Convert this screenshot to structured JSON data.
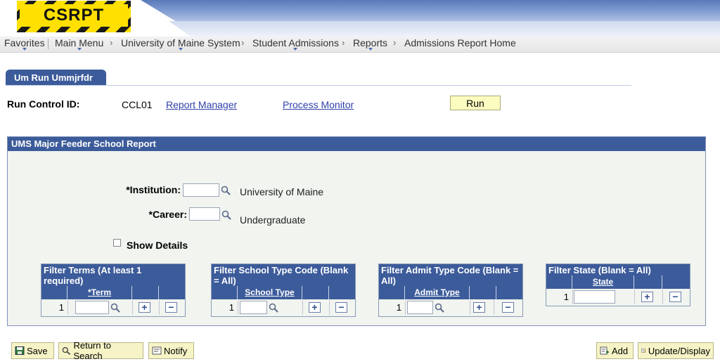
{
  "header": {
    "logo_text": "CSRPT"
  },
  "nav": {
    "items": [
      {
        "label": "Favorites"
      },
      {
        "label": "Main Menu"
      },
      {
        "label": "University of Maine System"
      },
      {
        "label": "Student Admissions"
      },
      {
        "label": "Reports"
      },
      {
        "label": "Admissions Report Home"
      }
    ],
    "separator": "›"
  },
  "tab": {
    "label": "Um Run Ummjrfdr"
  },
  "run_control": {
    "label": "Run Control ID:",
    "value": "CCL01",
    "report_manager_link": "Report Manager",
    "process_monitor_link": "Process Monitor",
    "run_button": "Run"
  },
  "report": {
    "title": "UMS Major Feeder School Report",
    "institution": {
      "label": "*Institution:",
      "value": "",
      "description": "University of Maine"
    },
    "career": {
      "label": "*Career:",
      "value": "",
      "description": "Undergraduate"
    },
    "show_details": {
      "label": "Show Details",
      "checked": false
    },
    "grids": [
      {
        "title": "Filter Terms (At least 1 required)",
        "column": "*Term",
        "row_number": "1",
        "value": ""
      },
      {
        "title": "Filter School Type Code (Blank = All)",
        "column": "School Type",
        "row_number": "1",
        "value": ""
      },
      {
        "title": "Filter Admit Type Code (Blank = All)",
        "column": "Admit Type",
        "row_number": "1",
        "value": ""
      },
      {
        "title": "Filter State (Blank = All)",
        "column": "State",
        "row_number": "1",
        "value": ""
      }
    ],
    "add_row_symbol": "+",
    "delete_row_symbol": "−"
  },
  "toolbar": {
    "save": "Save",
    "return_to_search": "Return to Search",
    "notify": "Notify",
    "add": "Add",
    "update_display": "Update/Display"
  },
  "colors": {
    "header_blue": "#3c5b9a",
    "run_button_bg": "#fdfcc0",
    "link": "#2f3fa8"
  }
}
